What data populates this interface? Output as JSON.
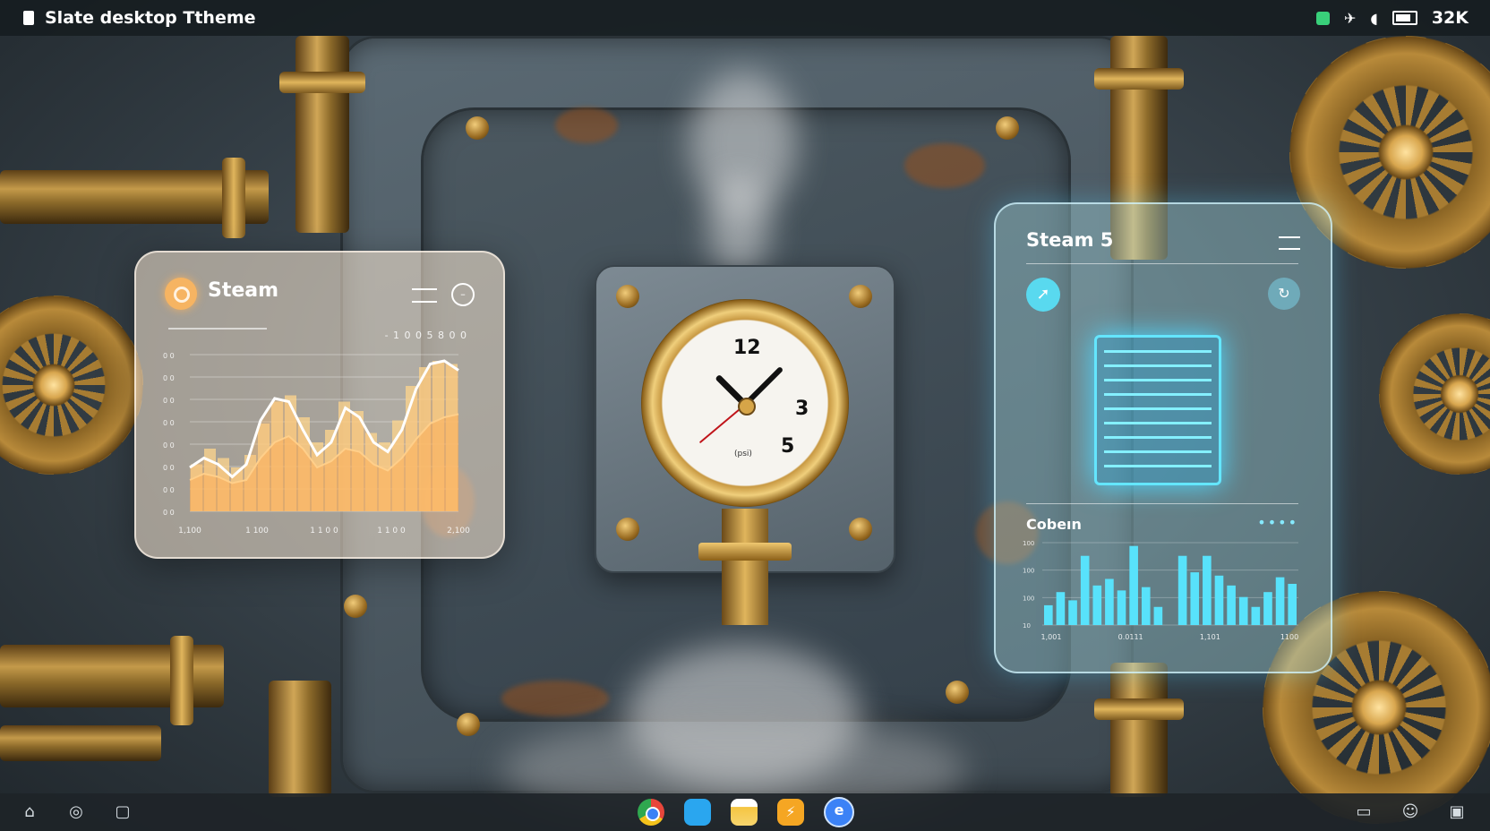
{
  "window": {
    "title": "Slate desktop Ttheme"
  },
  "tray": {
    "battery_text": "32K",
    "icons": [
      "app-status-icon",
      "network-icon",
      "mic-icon",
      "keyboard-battery-icon"
    ]
  },
  "widget_left": {
    "title": "Steam",
    "reading": "- 1 0 0 5 8 0 0",
    "chart_data": {
      "type": "area",
      "title": "Steam",
      "x_tick_labels": [
        "1,100",
        "1 100",
        "1 1 0 0",
        "1 1 0 0",
        "2,100"
      ],
      "y_tick_labels": [
        "0 0",
        "0 0",
        "0 0",
        "0 0",
        "0 0",
        "0 0",
        "0 0",
        "0 0"
      ],
      "series": [
        {
          "name": "",
          "values": [
            28,
            34,
            30,
            22,
            30,
            58,
            72,
            70,
            52,
            36,
            44,
            66,
            60,
            44,
            38,
            52,
            78,
            94,
            96,
            90
          ]
        },
        {
          "name": "",
          "values": [
            20,
            24,
            22,
            18,
            20,
            34,
            44,
            48,
            40,
            28,
            32,
            40,
            38,
            30,
            26,
            34,
            46,
            56,
            60,
            62
          ]
        }
      ],
      "bar_values": [
        30,
        40,
        34,
        28,
        36,
        56,
        70,
        74,
        60,
        44,
        52,
        70,
        64,
        50,
        44,
        58,
        80,
        92,
        96,
        94
      ]
    }
  },
  "widget_right": {
    "title": "Steam 5",
    "section_label": "Cobeın",
    "dots": "••••",
    "chart_data": {
      "type": "bar",
      "x_tick_labels": [
        "1,001",
        "0.0111",
        "1,101",
        "1100"
      ],
      "y_tick_labels": [
        "100",
        "100",
        "100",
        "10"
      ],
      "values": [
        24,
        40,
        30,
        84,
        48,
        56,
        42,
        96,
        46,
        22,
        36,
        84,
        64,
        84,
        60,
        48,
        34,
        22,
        40,
        58,
        50
      ]
    }
  },
  "gauge": {
    "numbers": [
      "12",
      "3",
      "5"
    ],
    "caption": "(psi)"
  },
  "taskbar": {
    "left_icons": [
      "home-icon",
      "steam-icon",
      "window-icon"
    ],
    "dock_apps": [
      "chrome-icon",
      "blue-app-icon",
      "files-icon",
      "orange-app-icon",
      "browser-icon"
    ],
    "right_icons": [
      "desktop-icon",
      "user-icon",
      "notification-icon"
    ]
  },
  "colors": {
    "accent_orange": "#f6b462",
    "accent_cyan": "#5ae0f8",
    "brass": "#c99a46"
  }
}
